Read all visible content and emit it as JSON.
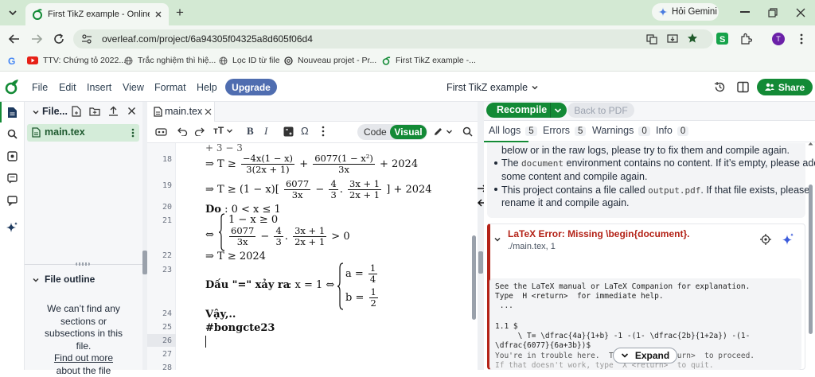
{
  "browser": {
    "tab_title": "First TikZ example - Online LaTe",
    "new_tab": "+",
    "gemini_label": "Hỏi Gemini",
    "url": "overleaf.com/project/6a94305f04325a8d605f06d4",
    "avatar_letter": "T",
    "bookmarks": [
      {
        "label": "TTV: Chứng tỏ 2022..."
      },
      {
        "label": "Trắc nghiệm thì hiệ..."
      },
      {
        "label": "Lọc ID từ file"
      },
      {
        "label": "Nouveau projet - Pr..."
      },
      {
        "label": "First TikZ example -..."
      }
    ]
  },
  "menu": {
    "file": "File",
    "edit": "Edit",
    "insert": "Insert",
    "view": "View",
    "format": "Format",
    "help": "Help",
    "upgrade": "Upgrade",
    "project_title": "First TikZ example",
    "share": "Share"
  },
  "file_panel": {
    "header": "File...",
    "file_name": "main.tex",
    "outline_title": "File outline",
    "outline_lines": [
      "We can’t find any",
      "sections or",
      "subsections in this",
      "file."
    ],
    "outline_link": "Find out more",
    "outline_cut": "about the file"
  },
  "editor": {
    "tab_label": "main.tex",
    "code_label": "Code",
    "visual_label": "Visual",
    "omega": "Ω",
    "text_size": "тT",
    "bold": "B",
    "italic": "I",
    "line_numbers": [
      "18",
      "19",
      "20",
      "21",
      "22",
      "23",
      "24",
      "25",
      "26",
      "27",
      "28"
    ],
    "lines": {
      "l17_partial": "+ 3 − 3",
      "l18_prefix": "⇒ T ≥",
      "l18_f1_num": "−4x(1 − x)",
      "l18_f1_den": "3(2x + 1)",
      "l18_plus": "+",
      "l18_f2_num": "6077(1 − x²)",
      "l18_f2_den": "3x",
      "l18_suffix": "+ 2024",
      "l19_prefix": "⇒ T ≥ (1 − x)[",
      "l19_f1_num": "6077",
      "l19_f1_den": "3x",
      "l19_minus": "−",
      "l19_f2_num": "4",
      "l19_f2_den": "3",
      "l19_dot": ".",
      "l19_f3_num": "3x + 1",
      "l19_f3_den": "2x + 1",
      "l19_suffix": "] + 2024",
      "l20_do": "Do",
      "l20_rest": ": 0 < x ≤ 1",
      "l21_iff": "⇔",
      "l21_row1": "1 − x ≥ 0",
      "l21_f1_num": "6077",
      "l21_f1_den": "3x",
      "l21_minus": "−",
      "l21_f2_num": "4",
      "l21_f2_den": "3",
      "l21_dot": ".",
      "l21_f3_num": "3x + 1",
      "l21_f3_den": "2x + 1",
      "l21_gt": "> 0",
      "l22": "⇒ T ≥ 2024",
      "l23_text": "Dấu \"=\" xảy ra",
      "l23_rest": ": x = 1 ⇔",
      "l23_a": "a =",
      "l23_a_num": "1",
      "l23_a_den": "4",
      "l23_b": "b =",
      "l23_b_num": "1",
      "l23_b_den": "2",
      "l24": "Vậy,..",
      "l25": "#bongcte23"
    }
  },
  "pdf_panel": {
    "recompile": "Recompile",
    "back_to_pdf": "Back to PDF",
    "tabs": [
      {
        "label": "All logs",
        "count": "5"
      },
      {
        "label": "Errors",
        "count": "5"
      },
      {
        "label": "Warnings",
        "count": "0"
      },
      {
        "label": "Info",
        "count": "0"
      }
    ],
    "log_top_line1": "below or in the raw logs, please try to fix them and compile again.",
    "bullet1_a": "The",
    "bullet1_code": "document",
    "bullet1_b": "environment contains no content. If it’s empty, please add",
    "bullet1_c": "some content and compile again.",
    "bullet2_a": "This project contains a file called",
    "bullet2_code": "output.pdf",
    "bullet2_b": ". If that file exists, please",
    "bullet2_c": "rename it and compile again.",
    "error_title": "LaTeX Error: Missing \\begin{document}.",
    "error_location": "./main.tex, 1",
    "raw_lines": [
      "See the LaTeX manual or LaTeX Companion for explanation.",
      "Type  H <return>  for immediate help.",
      " ...",
      "",
      "1.1 $",
      "     \\ T= \\dfrac{4a}{1+b} -1 -(1- \\dfrac{2b}{1+2a}) -(1-",
      "\\dfrac{6077}{6a+3b})$",
      "You're in trouble here.  Ti             urn>  to proceed.",
      "If that doesn't work, type  X <return>  to quit."
    ],
    "expand": "Expand"
  },
  "colors": {
    "chrome_bg": "#d3e9d3",
    "overleaf_green": "#138a36",
    "upgrade_blue": "#4f6db0",
    "error_red": "#b42318"
  }
}
